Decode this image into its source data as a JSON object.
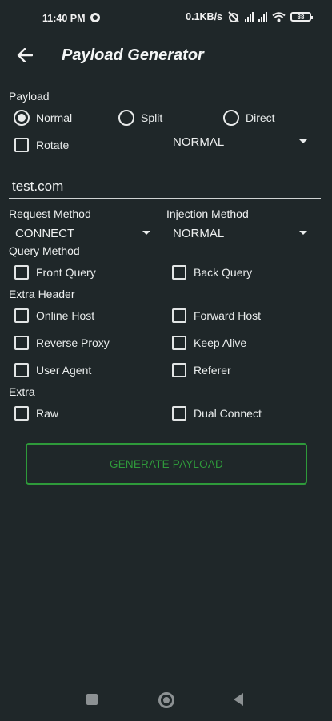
{
  "status_bar": {
    "time": "11:40 PM",
    "net_speed": "0.1KB/s",
    "battery": "88"
  },
  "app_bar": {
    "title": "Payload Generator"
  },
  "payload": {
    "section_label": "Payload",
    "radios": [
      {
        "label": "Normal",
        "selected": true
      },
      {
        "label": "Split",
        "selected": false
      },
      {
        "label": "Direct",
        "selected": false
      }
    ],
    "rotate_label": "Rotate",
    "split_dropdown_value": "NORMAL"
  },
  "host": {
    "value": "test.com"
  },
  "request_method": {
    "label": "Request Method",
    "value": "CONNECT"
  },
  "injection_method": {
    "label": "Injection Method",
    "value": "NORMAL"
  },
  "query_method": {
    "label": "Query Method",
    "options": [
      "Front Query",
      "Back Query"
    ]
  },
  "extra_header": {
    "label": "Extra Header",
    "options": [
      "Online Host",
      "Forward Host",
      "Reverse Proxy",
      "Keep Alive",
      "User Agent",
      "Referer"
    ]
  },
  "extra": {
    "label": "Extra",
    "options": [
      "Raw",
      "Dual Connect"
    ]
  },
  "generate_button": "GENERATE PAYLOAD",
  "colors": {
    "background": "#1f2729",
    "accent_green": "#2e9a3a"
  }
}
